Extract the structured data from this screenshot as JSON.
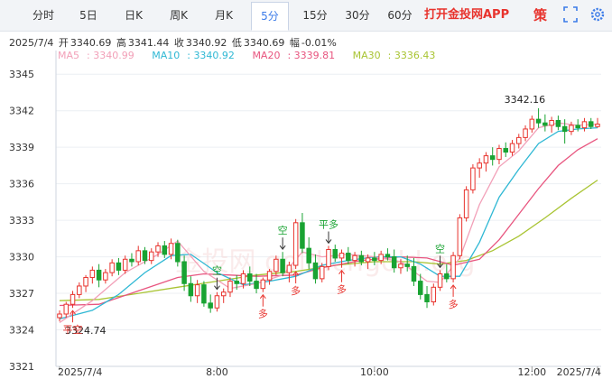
{
  "tabs": [
    {
      "label": "分时",
      "active": false
    },
    {
      "label": "5日",
      "active": false
    },
    {
      "label": "日K",
      "active": false
    },
    {
      "label": "周K",
      "active": false
    },
    {
      "label": "月K",
      "active": false
    },
    {
      "label": "5分",
      "active": true
    },
    {
      "label": "15分",
      "active": false
    },
    {
      "label": "30分",
      "active": false
    },
    {
      "label": "60分",
      "active": false
    }
  ],
  "app_link": "打开金投网APP",
  "toolbar": {
    "strategy_label": "策"
  },
  "info": {
    "date": "2025/7/4",
    "open_label": "开",
    "open": "3340.69",
    "high_label": "高",
    "high": "3341.44",
    "close_label": "收",
    "close": "3340.92",
    "low_label": "低",
    "low": "3340.69",
    "change_label": "幅",
    "change": "-0.01%"
  },
  "watermark": "金投网 gold.cngold.org",
  "colors": {
    "up": "#e8332d",
    "down": "#19a332",
    "ma5": "#f2a0b8",
    "ma10": "#2fb8d4",
    "ma20": "#e8557f",
    "ma30": "#a9c433"
  },
  "chart_data": {
    "type": "candlestick",
    "ylim": [
      3321,
      3346.5
    ],
    "yticks": [
      "3345",
      "3342",
      "3339",
      "3336",
      "3333",
      "3330",
      "3327",
      "3324",
      "3321"
    ],
    "xticks": [
      {
        "label": "2025/7/4",
        "index": 0
      },
      {
        "label": "8:00",
        "index": 24
      },
      {
        "label": "10:00",
        "index": 48
      },
      {
        "label": "12:00",
        "index": 72
      },
      {
        "label": "2025/7/4",
        "index": 82
      }
    ],
    "legend": [
      {
        "name": "MA5",
        "value": "3340.99",
        "color": "#f2a0b8"
      },
      {
        "name": "MA10",
        "value": "3340.92",
        "color": "#2fb8d4"
      },
      {
        "name": "MA20",
        "value": "3339.81",
        "color": "#e8557f"
      },
      {
        "name": "MA30",
        "value": "3336.43",
        "color": "#a9c433"
      }
    ],
    "high_label": "3342.16",
    "low_label": "3324.74",
    "candles": [
      [
        3325.0,
        3325.6,
        3324.7,
        3325.3
      ],
      [
        3325.3,
        3326.3,
        3325.0,
        3326.1
      ],
      [
        3326.1,
        3327.2,
        3325.8,
        3326.9
      ],
      [
        3326.9,
        3327.9,
        3326.6,
        3327.6
      ],
      [
        3327.6,
        3328.5,
        3327.1,
        3328.3
      ],
      [
        3328.3,
        3329.2,
        3327.8,
        3328.9
      ],
      [
        3328.9,
        3329.4,
        3327.5,
        3328.1
      ],
      [
        3328.1,
        3329.0,
        3327.8,
        3328.7
      ],
      [
        3328.7,
        3329.8,
        3328.4,
        3329.5
      ],
      [
        3329.5,
        3329.9,
        3328.5,
        3328.9
      ],
      [
        3328.9,
        3330.1,
        3328.6,
        3329.8
      ],
      [
        3329.8,
        3330.3,
        3329.2,
        3329.6
      ],
      [
        3329.6,
        3330.9,
        3329.3,
        3330.5
      ],
      [
        3330.5,
        3330.8,
        3329.4,
        3329.7
      ],
      [
        3329.7,
        3330.7,
        3329.4,
        3330.4
      ],
      [
        3330.4,
        3331.2,
        3330.0,
        3330.9
      ],
      [
        3330.9,
        3331.3,
        3329.9,
        3330.2
      ],
      [
        3330.2,
        3331.5,
        3329.8,
        3331.1
      ],
      [
        3331.1,
        3331.4,
        3329.2,
        3329.6
      ],
      [
        3329.6,
        3330.1,
        3327.2,
        3327.8
      ],
      [
        3327.8,
        3328.4,
        3326.3,
        3326.8
      ],
      [
        3326.8,
        3328.1,
        3326.2,
        3327.7
      ],
      [
        3327.7,
        3328.0,
        3325.9,
        3326.2
      ],
      [
        3326.2,
        3326.9,
        3325.4,
        3325.8
      ],
      [
        3325.8,
        3327.1,
        3325.5,
        3326.8
      ],
      [
        3326.8,
        3327.4,
        3326.2,
        3327.1
      ],
      [
        3327.1,
        3328.3,
        3326.7,
        3328.0
      ],
      [
        3328.0,
        3328.5,
        3327.3,
        3327.8
      ],
      [
        3327.8,
        3328.9,
        3327.4,
        3328.6
      ],
      [
        3328.6,
        3329.2,
        3327.6,
        3328.0
      ],
      [
        3328.0,
        3328.6,
        3327.0,
        3327.4
      ],
      [
        3327.4,
        3328.3,
        3327.1,
        3328.1
      ],
      [
        3328.1,
        3329.0,
        3327.7,
        3328.8
      ],
      [
        3328.8,
        3330.1,
        3328.5,
        3329.8
      ],
      [
        3329.8,
        3330.4,
        3328.4,
        3328.7
      ],
      [
        3328.7,
        3329.6,
        3327.9,
        3329.3
      ],
      [
        3329.3,
        3333.1,
        3329.0,
        3332.8
      ],
      [
        3332.8,
        3333.6,
        3330.3,
        3330.7
      ],
      [
        3330.7,
        3331.6,
        3329.0,
        3329.5
      ],
      [
        3329.5,
        3330.2,
        3327.8,
        3328.2
      ],
      [
        3328.2,
        3329.5,
        3327.9,
        3329.2
      ],
      [
        3329.2,
        3330.9,
        3328.9,
        3330.6
      ],
      [
        3330.6,
        3331.0,
        3329.6,
        3329.9
      ],
      [
        3329.9,
        3330.6,
        3329.1,
        3330.3
      ],
      [
        3330.3,
        3330.8,
        3329.4,
        3329.7
      ],
      [
        3329.7,
        3330.4,
        3329.2,
        3330.1
      ],
      [
        3330.1,
        3330.5,
        3329.3,
        3329.6
      ],
      [
        3329.6,
        3330.2,
        3329.0,
        3329.9
      ],
      [
        3329.9,
        3330.4,
        3329.3,
        3329.7
      ],
      [
        3329.7,
        3330.5,
        3329.4,
        3330.2
      ],
      [
        3330.2,
        3330.7,
        3329.7,
        3330.0
      ],
      [
        3330.0,
        3330.6,
        3328.7,
        3329.1
      ],
      [
        3329.1,
        3329.8,
        3328.6,
        3329.4
      ],
      [
        3329.4,
        3330.1,
        3328.8,
        3329.2
      ],
      [
        3329.2,
        3329.9,
        3327.6,
        3328.0
      ],
      [
        3328.0,
        3328.6,
        3326.5,
        3326.9
      ],
      [
        3326.9,
        3327.6,
        3325.8,
        3326.3
      ],
      [
        3326.3,
        3327.8,
        3326.0,
        3327.5
      ],
      [
        3327.5,
        3328.9,
        3327.2,
        3328.6
      ],
      [
        3328.6,
        3329.4,
        3327.9,
        3328.2
      ],
      [
        3328.2,
        3330.4,
        3327.9,
        3330.1
      ],
      [
        3330.1,
        3333.5,
        3329.8,
        3333.2
      ],
      [
        3333.2,
        3335.8,
        3332.9,
        3335.5
      ],
      [
        3335.5,
        3337.6,
        3335.2,
        3337.3
      ],
      [
        3337.3,
        3338.1,
        3336.5,
        3337.7
      ],
      [
        3337.7,
        3338.6,
        3337.0,
        3338.3
      ],
      [
        3338.3,
        3339.0,
        3337.5,
        3338.0
      ],
      [
        3338.0,
        3339.2,
        3337.6,
        3338.9
      ],
      [
        3338.9,
        3339.4,
        3338.2,
        3338.6
      ],
      [
        3338.6,
        3339.6,
        3338.3,
        3339.3
      ],
      [
        3339.3,
        3340.1,
        3338.9,
        3339.8
      ],
      [
        3339.8,
        3340.8,
        3339.5,
        3340.5
      ],
      [
        3340.5,
        3341.6,
        3340.2,
        3341.3
      ],
      [
        3341.3,
        3342.2,
        3340.6,
        3341.0
      ],
      [
        3341.0,
        3341.7,
        3340.3,
        3340.8
      ],
      [
        3340.8,
        3341.5,
        3340.2,
        3341.2
      ],
      [
        3341.2,
        3341.6,
        3340.4,
        3340.7
      ],
      [
        3340.7,
        3341.3,
        3339.3,
        3340.3
      ],
      [
        3340.3,
        3341.1,
        3340.0,
        3340.8
      ],
      [
        3340.8,
        3341.3,
        3340.3,
        3340.6
      ],
      [
        3340.6,
        3341.4,
        3340.3,
        3341.1
      ],
      [
        3341.1,
        3341.4,
        3340.5,
        3340.7
      ],
      [
        3340.7,
        3341.4,
        3340.6,
        3340.9
      ]
    ],
    "ma": {
      "ma5": [
        [
          0,
          3324.6
        ],
        [
          5,
          3326.4
        ],
        [
          10,
          3328.7
        ],
        [
          15,
          3330.2
        ],
        [
          18,
          3331.3
        ],
        [
          22,
          3328.8
        ],
        [
          26,
          3327.4
        ],
        [
          30,
          3327.8
        ],
        [
          34,
          3328.5
        ],
        [
          37,
          3330.4
        ],
        [
          40,
          3330.0
        ],
        [
          44,
          3330.2
        ],
        [
          48,
          3330.0
        ],
        [
          52,
          3329.6
        ],
        [
          56,
          3328.0
        ],
        [
          58,
          3327.9
        ],
        [
          61,
          3329.9
        ],
        [
          64,
          3334.3
        ],
        [
          67,
          3337.4
        ],
        [
          70,
          3338.7
        ],
        [
          73,
          3340.6
        ],
        [
          76,
          3341.0
        ],
        [
          79,
          3340.8
        ],
        [
          82,
          3340.9
        ]
      ],
      "ma10": [
        [
          0,
          3324.9
        ],
        [
          5,
          3325.6
        ],
        [
          9,
          3326.9
        ],
        [
          13,
          3328.7
        ],
        [
          17,
          3330.1
        ],
        [
          20,
          3330.2
        ],
        [
          24,
          3328.7
        ],
        [
          28,
          3327.7
        ],
        [
          32,
          3328.0
        ],
        [
          36,
          3328.4
        ],
        [
          40,
          3329.3
        ],
        [
          44,
          3329.7
        ],
        [
          48,
          3330.0
        ],
        [
          52,
          3330.0
        ],
        [
          55,
          3329.4
        ],
        [
          58,
          3328.4
        ],
        [
          61,
          3328.4
        ],
        [
          64,
          3331.2
        ],
        [
          67,
          3334.9
        ],
        [
          70,
          3337.2
        ],
        [
          73,
          3339.3
        ],
        [
          76,
          3340.3
        ],
        [
          79,
          3340.5
        ],
        [
          82,
          3340.6
        ]
      ],
      "ma20": [
        [
          0,
          3326.0
        ],
        [
          6,
          3326.1
        ],
        [
          12,
          3327.2
        ],
        [
          18,
          3328.3
        ],
        [
          22,
          3328.6
        ],
        [
          26,
          3328.5
        ],
        [
          30,
          3328.4
        ],
        [
          36,
          3328.5
        ],
        [
          40,
          3329.1
        ],
        [
          46,
          3329.7
        ],
        [
          52,
          3330.0
        ],
        [
          56,
          3329.9
        ],
        [
          60,
          3329.3
        ],
        [
          64,
          3329.8
        ],
        [
          67,
          3331.4
        ],
        [
          70,
          3333.5
        ],
        [
          73,
          3335.6
        ],
        [
          76,
          3337.5
        ],
        [
          79,
          3338.8
        ],
        [
          82,
          3339.7
        ]
      ],
      "ma30": [
        [
          0,
          3326.4
        ],
        [
          6,
          3326.5
        ],
        [
          12,
          3327.0
        ],
        [
          18,
          3327.5
        ],
        [
          24,
          3328.0
        ],
        [
          30,
          3328.5
        ],
        [
          36,
          3328.8
        ],
        [
          42,
          3329.3
        ],
        [
          48,
          3329.6
        ],
        [
          54,
          3329.6
        ],
        [
          58,
          3329.4
        ],
        [
          62,
          3329.7
        ],
        [
          66,
          3330.5
        ],
        [
          70,
          3331.7
        ],
        [
          74,
          3333.2
        ],
        [
          78,
          3334.8
        ],
        [
          82,
          3336.3
        ]
      ]
    },
    "annotations": [
      {
        "kind": "sell",
        "label": "空",
        "index": 24
      },
      {
        "kind": "sell",
        "label": "空",
        "index": 34
      },
      {
        "kind": "sell",
        "label": "平多",
        "index": 41
      },
      {
        "kind": "sell",
        "label": "空",
        "index": 58
      },
      {
        "kind": "buy",
        "label": "平空",
        "index": 2
      },
      {
        "kind": "buy",
        "label": "多",
        "index": 31
      },
      {
        "kind": "buy",
        "label": "多",
        "index": 36
      },
      {
        "kind": "buy",
        "label": "多",
        "index": 43
      },
      {
        "kind": "buy",
        "label": "多",
        "index": 60
      }
    ]
  }
}
